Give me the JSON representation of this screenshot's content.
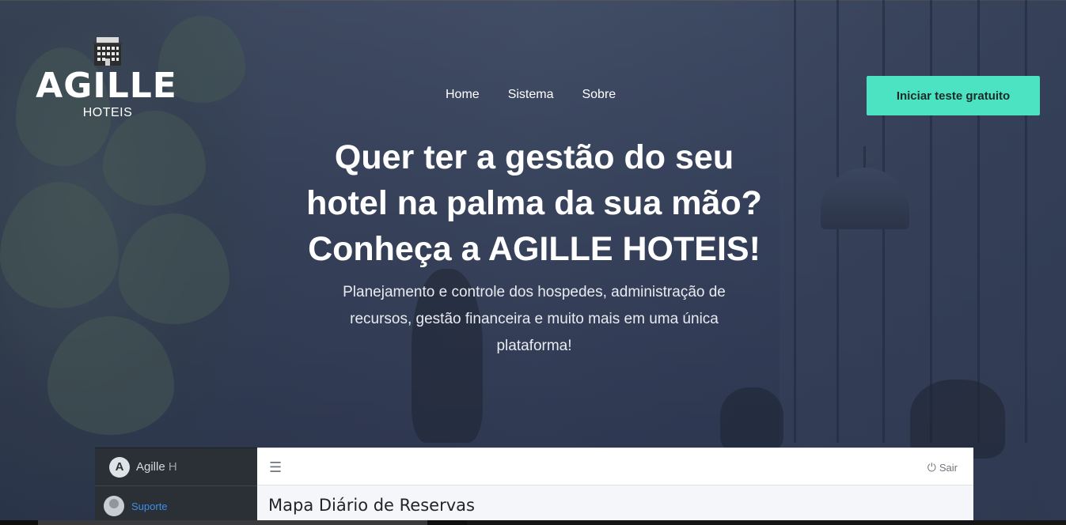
{
  "brand": {
    "name": "AGILLE",
    "tagline": "HOTEIS",
    "icon": "hotel-building-icon"
  },
  "nav": {
    "items": [
      {
        "label": "Home"
      },
      {
        "label": "Sistema"
      },
      {
        "label": "Sobre"
      }
    ]
  },
  "cta": {
    "label": "Iniciar teste gratuito",
    "color": "#4be3c2"
  },
  "hero": {
    "headline_lines": [
      "Quer ter a gestão do seu",
      "hotel na palma da sua mão?",
      "Conheça a AGILLE HOTEIS!"
    ],
    "subtitle": "Planejamento e controle dos hospedes, administração de recursos, gestão financeira e muito mais em uma única plataforma!"
  },
  "preview": {
    "brand_text": "Agille",
    "brand_suffix": "H",
    "brand_icon": "A",
    "user_label": "Suporte",
    "menu_icon": "☰",
    "logout_icon": "⏻",
    "logout_label": "Sair",
    "page_title": "Mapa Diário de Reservas"
  }
}
